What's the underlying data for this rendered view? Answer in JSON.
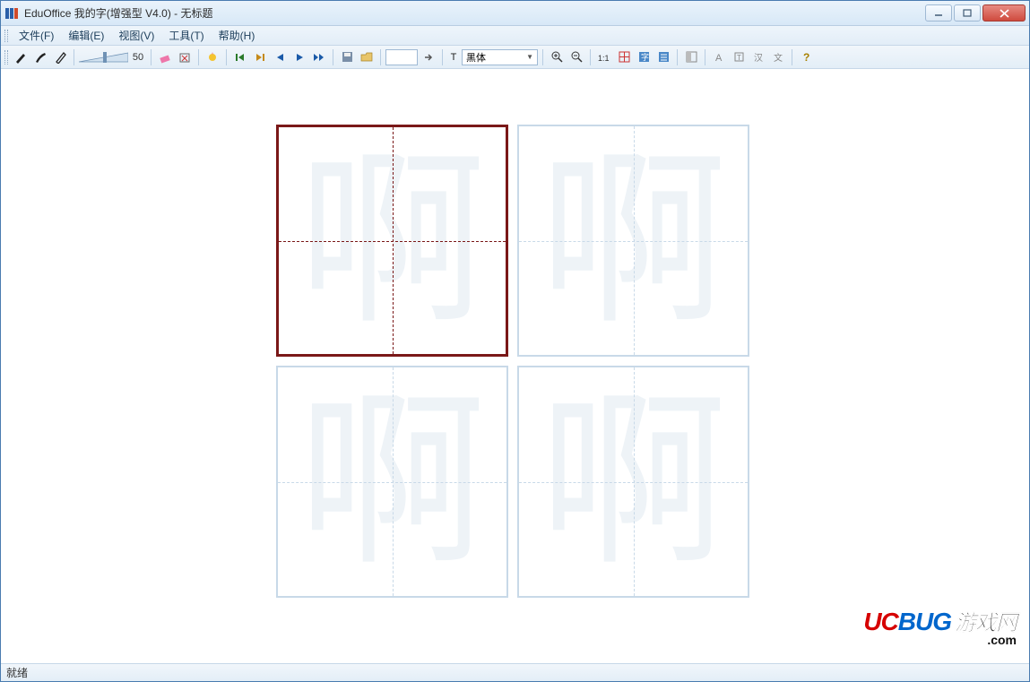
{
  "title": "EduOffice 我的字(增强型 V4.0) - 无标题",
  "menu": {
    "file": "文件(F)",
    "edit": "编辑(E)",
    "view": "视图(V)",
    "tools": "工具(T)",
    "help": "帮助(H)"
  },
  "toolbar": {
    "thickness_value": "50",
    "input_value": "",
    "font_prefix": "T",
    "font_name": "黑体"
  },
  "practice_char": "啊",
  "watermark": {
    "uc": "UC",
    "bug": "BUG",
    "cn": "游戏网",
    "dotcom": ".com"
  },
  "status": "就绪"
}
